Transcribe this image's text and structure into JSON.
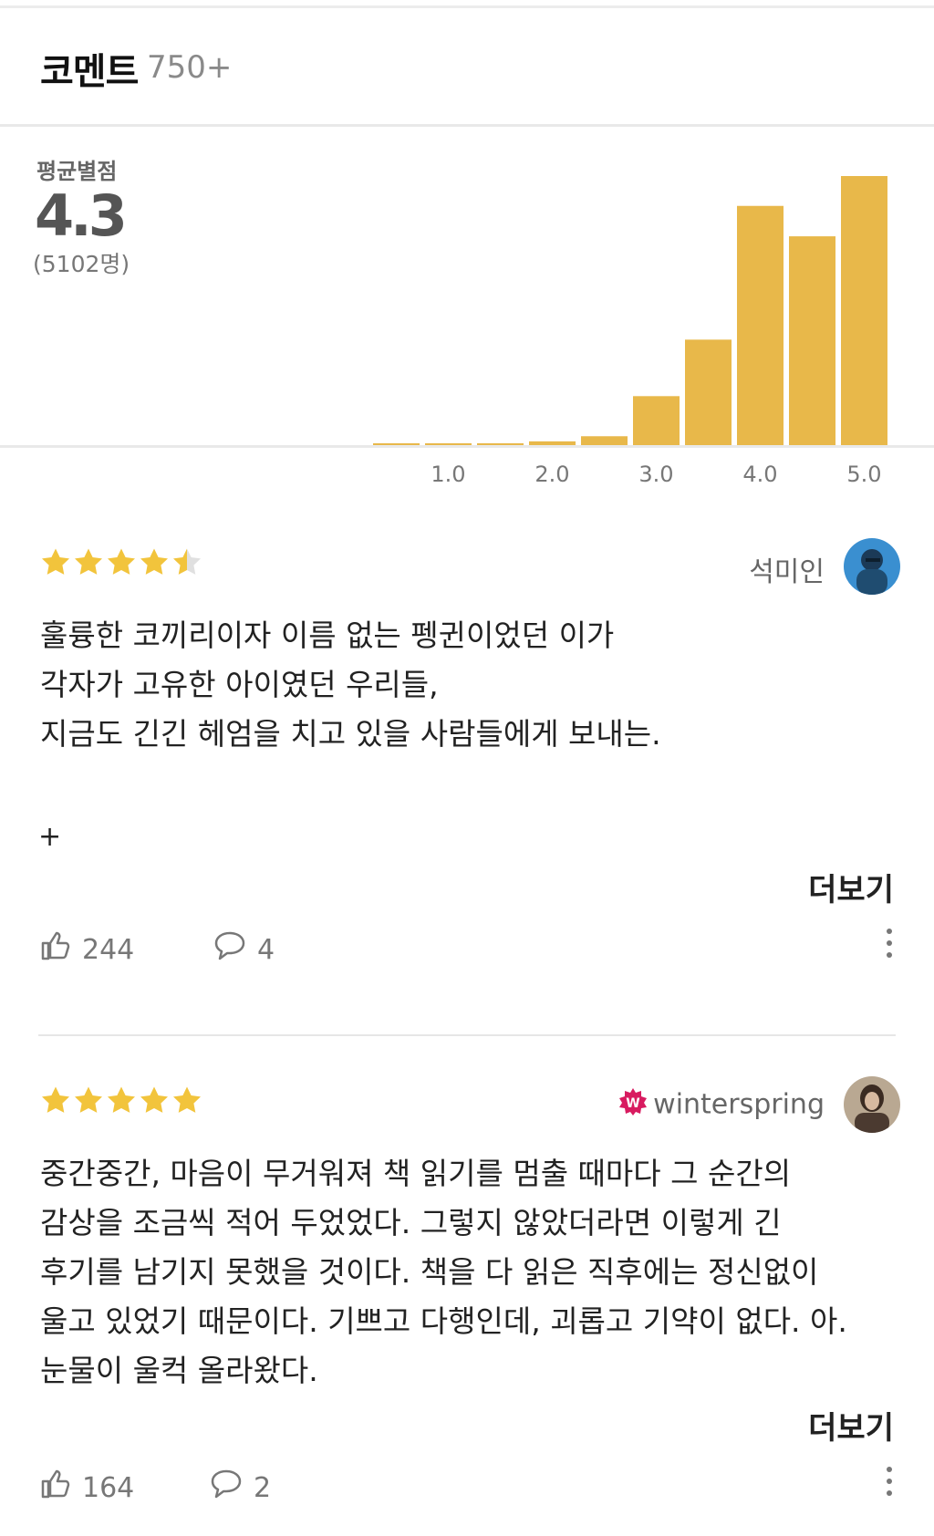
{
  "header": {
    "title": "코멘트",
    "count": "750+"
  },
  "rating": {
    "label": "평균별점",
    "value": "4.3",
    "participants": "(5102명)"
  },
  "chart_data": {
    "type": "bar",
    "x": [
      0.5,
      1.0,
      1.5,
      2.0,
      2.5,
      3.0,
      3.5,
      4.0,
      4.5,
      5.0
    ],
    "values": [
      0.3,
      0.3,
      0.5,
      1.4,
      3.3,
      18.2,
      39.2,
      88.9,
      77.6,
      100
    ],
    "tick_labels": [
      "1.0",
      "2.0",
      "3.0",
      "4.0",
      "5.0"
    ],
    "ylim": [
      0,
      100
    ],
    "color": "#e8b84a"
  },
  "reviews": [
    {
      "stars": 4.5,
      "author": "석미인",
      "text": "훌륭한 코끼리이자 이름 없는 펭귄이었던 이가\n각자가 고유한 아이였던 우리들,\n지금도 긴긴 헤엄을 치고 있을 사람들에게 보내는.",
      "extra": "+",
      "more": "더보기",
      "likes": "244",
      "comments": "4"
    },
    {
      "stars": 5,
      "author": "winterspring",
      "text": "중간중간, 마음이 무거워져 책 읽기를 멈출 때마다 그 순간의\n감상을 조금씩 적어 두었었다. 그렇지 않았더라면 이렇게 긴\n후기를 남기지 못했을 것이다. 책을 다 읽은 직후에는 정신없이\n울고 있었기 때문이다. 기쁘고 다행인데, 괴롭고 기약이 없다. 아.\n눈물이 울컥 올라왔다.",
      "more": "더보기",
      "likes": "164",
      "comments": "2"
    }
  ],
  "colors": {
    "star": "#f2c43c",
    "star_empty": "#e0e0e0",
    "bar": "#e8b84a",
    "badge": "#d81b60"
  }
}
